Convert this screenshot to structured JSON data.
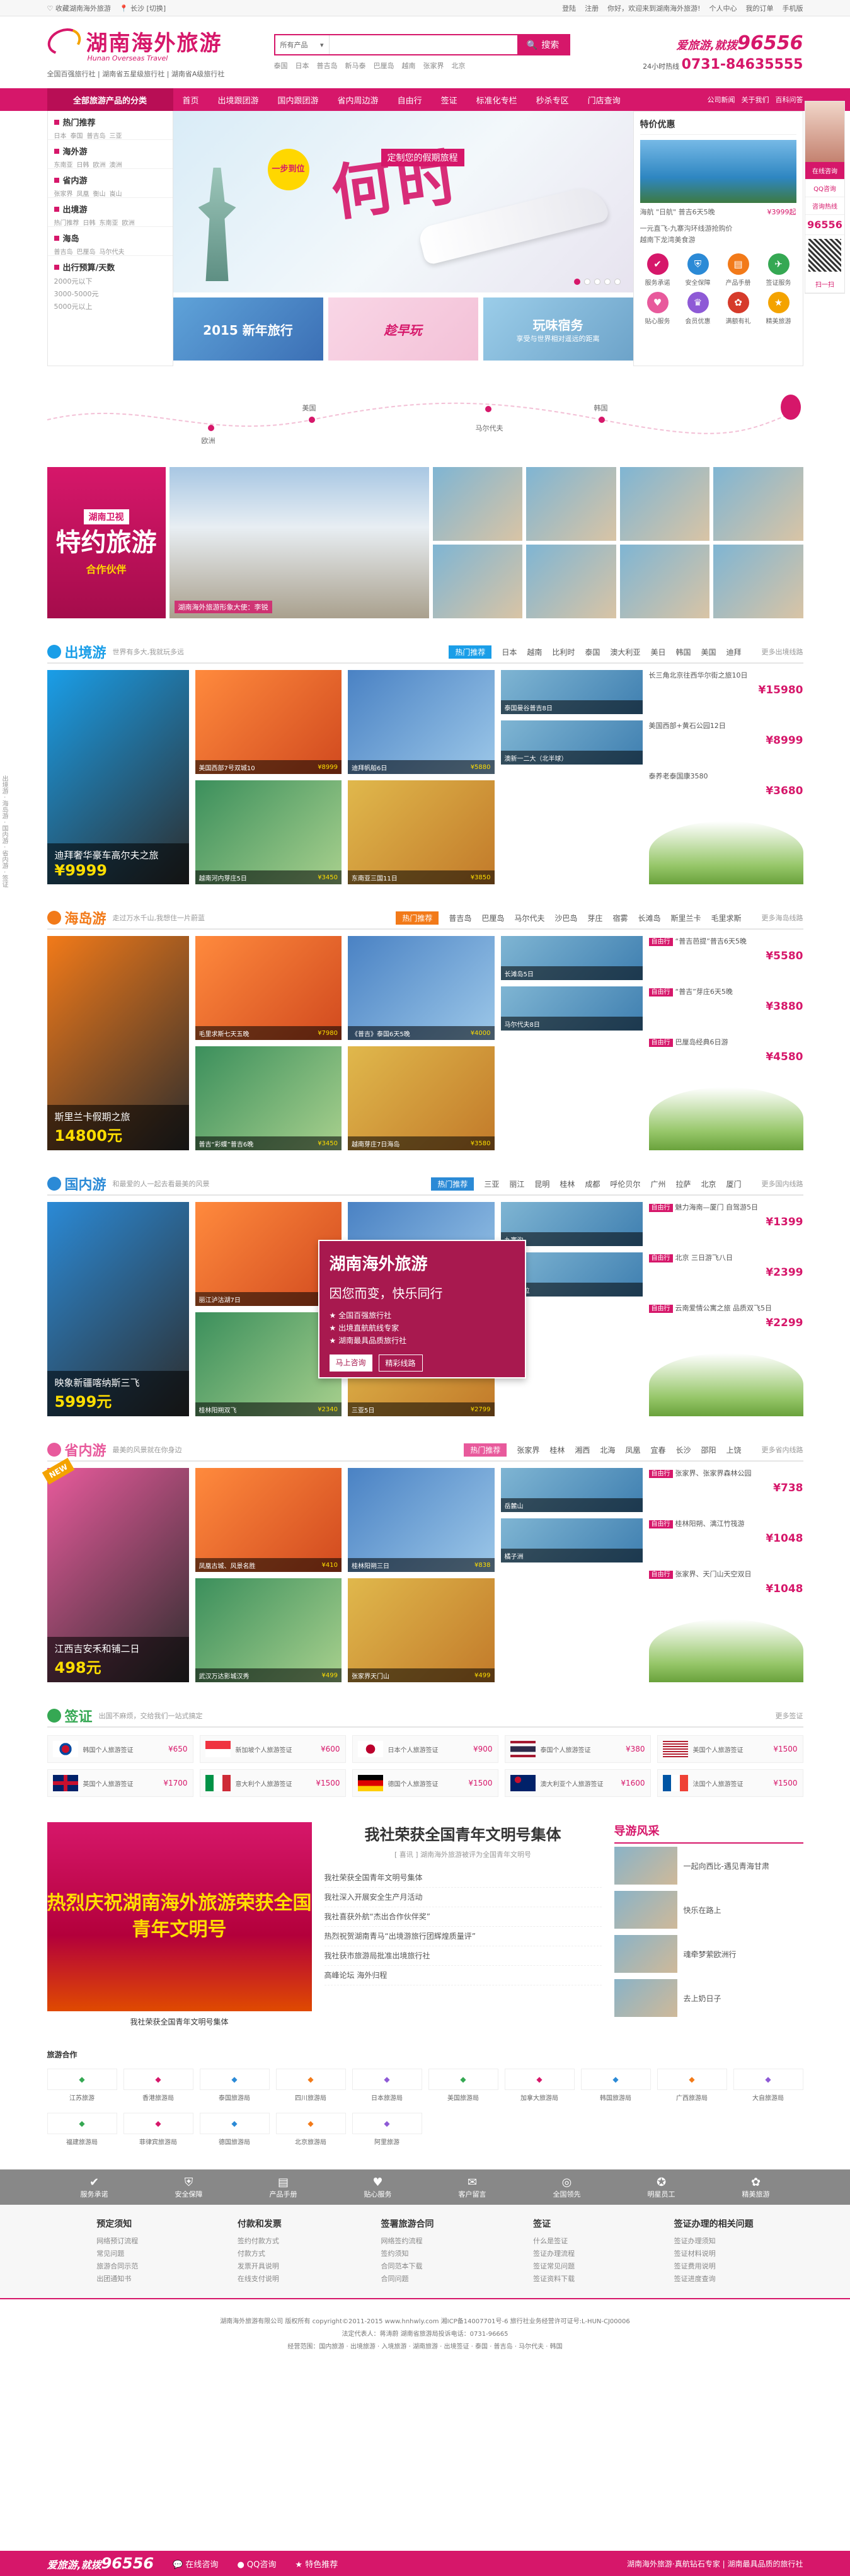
{
  "topbar": {
    "left": [
      "♡ 收藏湖南海外旅游",
      "📍 长沙 [切换]"
    ],
    "right": [
      "登陆",
      "注册",
      "你好，欢迎来到湖南海外旅游!",
      "个人中心",
      "我的订单",
      "手机版"
    ]
  },
  "header": {
    "logo_cn": "湖南海外旅游",
    "logo_en": "Hunan Overseas Travel",
    "slogan": "全国百强旅行社 | 湖南省五星级旅行社 | 湖南省A级旅行社",
    "search_select": "所有产品",
    "search_placeholder": "",
    "search_button": "搜索",
    "hotwords": [
      "泰国",
      "日本",
      "普吉岛",
      "新马泰",
      "巴厘岛",
      "越南",
      "张家界",
      "北京"
    ],
    "hotline_slogan_pre": "爱旅游,就拨",
    "hotline_slogan_num": "96556",
    "hotline_label": "24小时热线",
    "hotline_number": "0731-84635555"
  },
  "nav": {
    "category": "全部旅游产品的分类",
    "items": [
      "首页",
      "出境跟团游",
      "国内跟团游",
      "省内周边游",
      "自由行",
      "签证",
      "标准化专栏",
      "秒杀专区",
      "门店查询"
    ],
    "right": [
      "公司新闻",
      "关于我们",
      "百科问答"
    ]
  },
  "side_menu": {
    "groups": [
      {
        "title": "热门推荐",
        "links": [
          "日本",
          "泰国",
          "普吉岛",
          "三亚"
        ]
      },
      {
        "title": "海外游",
        "links": [
          "东南亚",
          "日韩",
          "欧洲",
          "澳洲"
        ]
      },
      {
        "title": "省内游",
        "links": [
          "张家界",
          "凤凰",
          "衡山",
          "崀山"
        ]
      },
      {
        "title": "出境游",
        "links": [
          "热门推荐",
          "日韩",
          "东南亚",
          "欧洲"
        ]
      },
      {
        "title": "海岛",
        "links": [
          "普吉岛",
          "巴厘岛",
          "马尔代夫"
        ]
      },
      {
        "title": "出行预算/天数",
        "links": [
          "2000元以下",
          "3000-5000元",
          "5000元以上"
        ]
      }
    ]
  },
  "banner": {
    "badge": "一步到位",
    "title": "何时",
    "sub": "定制您的假期旅程",
    "promos": [
      "2015 新年旅行",
      "趁早玩",
      "玩味宿务"
    ],
    "promo3_sub": "享受与世界相对遥远的距离"
  },
  "special": {
    "title": "特价优惠",
    "item_name": "海航 \"日航\" 普吉6天5晚",
    "item_price": "¥3999起",
    "list": [
      "一元直飞-九寨沟环线游抢购价",
      "越南下龙湾美食游"
    ],
    "services": [
      "服务承诺",
      "安全保障",
      "产品手册",
      "签证服务",
      "贴心服务",
      "会员优惠",
      "满额有礼",
      "精美旅游"
    ]
  },
  "float_panel": {
    "online": "在线咨询",
    "qq": "QQ咨询",
    "hotline_label": "咨询热线",
    "hotline": "96556",
    "scan": "扫一扫"
  },
  "left_tabs": [
    "出境游",
    "海岛游",
    "国内游",
    "省内游",
    "签证"
  ],
  "route": {
    "cities": [
      "欧洲",
      "美国",
      "马尔代夫",
      "韩国"
    ]
  },
  "feature": {
    "brand": "湖南卫视",
    "main": "特约旅游",
    "sub": "合作伙伴",
    "caption": "湖南海外旅游形象大使：李锐"
  },
  "sections": [
    {
      "key": "outbound",
      "title": "出境游",
      "desc": "世界有多大,我就玩多远",
      "color": "#1a9ee8",
      "hot": "热门推荐",
      "tabs": [
        "日本",
        "越南",
        "比利时",
        "泰国",
        "澳大利亚",
        "美日",
        "韩国",
        "美国",
        "迪拜"
      ],
      "more": "更多出境线路",
      "feature_title": "迪拜奢华豪车高尔夫之旅",
      "feature_price": "¥9999",
      "tiles": [
        {
          "name": "美国西部7号双城10",
          "price": "¥8999"
        },
        {
          "name": "迪拜帆船6日",
          "price": "¥5880"
        },
        {
          "name": "越南河内芽庄5日",
          "price": "¥3450"
        },
        {
          "name": "东南亚三国11日",
          "price": "¥3850"
        }
      ],
      "side": [
        {
          "tag": "",
          "text": "长三角北京往西华尔街之旅10日",
          "price": "¥15980"
        },
        {
          "tag": "",
          "text": "美国西部+黄石公园12日",
          "price": "¥8999"
        },
        {
          "tag": "",
          "text": "泰养老泰国康3580",
          "price": "¥3680"
        }
      ],
      "side_img_cap": [
        "泰国曼谷普吉8日",
        "澳新一二大（北半球）"
      ]
    },
    {
      "key": "island",
      "title": "海岛游",
      "desc": "走过万水千山,我想住一片蔚蓝",
      "color": "#f27a19",
      "hot": "热门推荐",
      "tabs": [
        "普吉岛",
        "巴厘岛",
        "马尔代夫",
        "沙巴岛",
        "芽庄",
        "宿雾",
        "长滩岛",
        "斯里兰卡",
        "毛里求斯"
      ],
      "more": "更多海岛线路",
      "feature_title": "斯里兰卡假期之旅",
      "feature_price": "14800元",
      "tiles": [
        {
          "name": "毛里求斯七天五晚",
          "price": "¥7980"
        },
        {
          "name": "《普吉》泰国6天5晚",
          "price": "¥4000"
        },
        {
          "name": "普吉“彩蝶”普吉6晚",
          "price": "¥3450"
        },
        {
          "name": "越南芽庄7日海岛",
          "price": "¥3580"
        }
      ],
      "side": [
        {
          "tag": "自由行",
          "text": "“普吉芭提”普吉6天5晚",
          "price": "¥5580"
        },
        {
          "tag": "自由行",
          "text": "“普吉”芽庄6天5晚",
          "price": "¥3880"
        },
        {
          "tag": "自由行",
          "text": "巴厘岛经典6日游",
          "price": "¥4580"
        }
      ],
      "side_img_cap": [
        "长滩岛5日",
        "马尔代夫8日"
      ]
    },
    {
      "key": "domestic",
      "title": "国内游",
      "desc": "和最爱的人一起去看最美的风景",
      "color": "#2b8ad6",
      "hot": "热门推荐",
      "tabs": [
        "三亚",
        "丽江",
        "昆明",
        "桂林",
        "成都",
        "呼伦贝尔",
        "广州",
        "拉萨",
        "北京",
        "厦门"
      ],
      "more": "更多国内线路",
      "feature_title": "映象新疆喀纳斯三飞",
      "feature_price": "5999元",
      "tiles": [
        {
          "name": "丽江泸沽湖7日",
          "price": "¥2880"
        },
        {
          "name": "北京双飞5日",
          "price": "¥2350"
        },
        {
          "name": "桂林阳朔双飞",
          "price": "¥2340"
        },
        {
          "name": "三亚5日",
          "price": "¥2799"
        }
      ],
      "side": [
        {
          "tag": "自由行",
          "text": "魅力海南—厦门 自驾游5日",
          "price": "¥1399"
        },
        {
          "tag": "自由行",
          "text": "北京 三日游飞八日",
          "price": "¥2399"
        },
        {
          "tag": "自由行",
          "text": "云南爱情公寓之旅 品质双飞5日",
          "price": "¥2299"
        }
      ],
      "side_img_cap": [
        "九寨沟",
        "香格里拉"
      ],
      "ad_brand": "湖南海外旅游",
      "ad_headline": "因您而变，快乐同行",
      "ad_points": [
        "全国百强旅行社",
        "出境直航航线专家",
        "湖南最具品质旅行社"
      ],
      "ad_btn1": "马上咨询",
      "ad_btn2": "精彩线路"
    },
    {
      "key": "province",
      "title": "省内游",
      "desc": "最美的风景就在你身边",
      "color": "#e85a9c",
      "hot": "热门推荐",
      "tabs": [
        "张家界",
        "桂林",
        "湘西",
        "北海",
        "凤凰",
        "宜春",
        "长沙",
        "邵阳",
        "上饶"
      ],
      "more": "更多省内线路",
      "feature_title": "江西吉安禾和铺二日",
      "feature_price": "498元",
      "tiles": [
        {
          "name": "凤凰古城、风景名胜",
          "price": "¥410"
        },
        {
          "name": "桂林阳朔三日",
          "price": "¥838"
        },
        {
          "name": "武汉万达影城汉秀",
          "price": "¥499"
        },
        {
          "name": "张家界天门山",
          "price": "¥499"
        }
      ],
      "side": [
        {
          "tag": "自由行",
          "text": "张家界、张家界森林公园",
          "price": "¥738"
        },
        {
          "tag": "自由行",
          "text": "桂林阳朔、漓江竹筏游",
          "price": "¥1048"
        },
        {
          "tag": "自由行",
          "text": "张家界、天门山天空双日",
          "price": "¥1048"
        }
      ],
      "side_img_cap": [
        "岳麓山",
        "橘子洲"
      ]
    }
  ],
  "visa": {
    "title": "签证",
    "desc": "出国不麻烦，交给我们一站式搞定",
    "more": "更多签证",
    "items": [
      {
        "name": "韩国个人旅游签证",
        "price": "¥650"
      },
      {
        "name": "新加坡个人旅游签证",
        "price": "¥600"
      },
      {
        "name": "日本个人旅游签证",
        "price": "¥900"
      },
      {
        "name": "泰国个人旅游签证",
        "price": "¥380"
      },
      {
        "name": "美国个人旅游签证",
        "price": "¥1500"
      },
      {
        "name": "英国个人旅游签证",
        "price": "¥1700"
      },
      {
        "name": "意大利个人旅游签证",
        "price": "¥1500"
      },
      {
        "name": "德国个人旅游签证",
        "price": "¥1500"
      },
      {
        "name": "澳大利亚个人旅游签证",
        "price": "¥1600"
      },
      {
        "name": "法国个人旅游签证",
        "price": "¥1500"
      }
    ]
  },
  "news": {
    "img_text": "热烈庆祝湖南海外旅游荣获全国青年文明号",
    "img_caption": "我社荣获全国青年文明号集体",
    "title": "我社荣获全国青年文明号集体",
    "sub": "[ 喜讯 ] 湖南海外旅游被评为全国青年文明号",
    "list": [
      "我社荣获全国青年文明号集体",
      "我社深入开展安全生产月活动",
      "我社喜获外航“杰出合作伙伴奖”",
      "热烈祝贺湖南青马“出境游旅行团辉煌质量评”",
      "我社获市旅游局批准出境旅行社",
      "高峰论坛 海外归程"
    ]
  },
  "guide": {
    "title": "导游风采",
    "items": [
      "一起向西比-遇见青海甘肃",
      "快乐在路上",
      "魂牵梦萦欧洲行",
      "去上奶日子"
    ]
  },
  "partners": {
    "title": "旅游合作",
    "items": [
      "江苏旅游",
      "香港旅游局",
      "泰国旅游局",
      "四川旅游局",
      "日本旅游局",
      "美国旅游局",
      "加拿大旅游局",
      "韩国旅游局",
      "广西旅游局",
      "大自旅游局",
      "福建旅游局",
      "菲律宾旅游局",
      "德国旅游局",
      "北京旅游局",
      "阿里旅游"
    ]
  },
  "service_bar": [
    "服务承诺",
    "安全保障",
    "产品手册",
    "贴心服务",
    "客户留言",
    "全国领先",
    "明星员工",
    "精美旅游"
  ],
  "footer_links": [
    {
      "title": "预定须知",
      "items": [
        "网络预订流程",
        "常见问题",
        "旅游合同示范",
        "出团通知书"
      ]
    },
    {
      "title": "付款和发票",
      "items": [
        "签约付款方式",
        "付款方式",
        "发票开具说明",
        "在线支付说明"
      ]
    },
    {
      "title": "签署旅游合同",
      "items": [
        "网络签约流程",
        "签约须知",
        "合同范本下载",
        "合同问题"
      ]
    },
    {
      "title": "签证",
      "items": [
        "什么是签证",
        "签证办理流程",
        "签证常见问题",
        "签证资料下载"
      ]
    },
    {
      "title": "签证办理的相关问题",
      "items": [
        "签证办理须知",
        "签证材料说明",
        "签证费用说明",
        "签证进度查询"
      ]
    }
  ],
  "copyright": {
    "line1": "湖南海外旅游有限公司 版权所有 copyright©2011-2015 www.hnhwly.com 湘ICP备14007701号-6 旅行社业务经营许可证号:L-HUN-CJ00006",
    "line2": "法定代表人：蒋涛蔚 湖南省旅游局投诉电话：0731-96665",
    "line3": "经营范围：国内旅游 · 出境旅游 · 入境旅游 · 湖南旅游 · 出境签证 · 泰国 · 普吉岛 · 马尔代夫 · 韩国"
  },
  "bottom_bar": {
    "brand_pre": "爱旅游,就拨",
    "brand_num": "96556",
    "online": "在线咨询",
    "qq": "QQ咨询",
    "special": "特色推荐",
    "right": "湖南海外旅游·真航钻石专家 | 湖南最具品质的旅行社"
  }
}
